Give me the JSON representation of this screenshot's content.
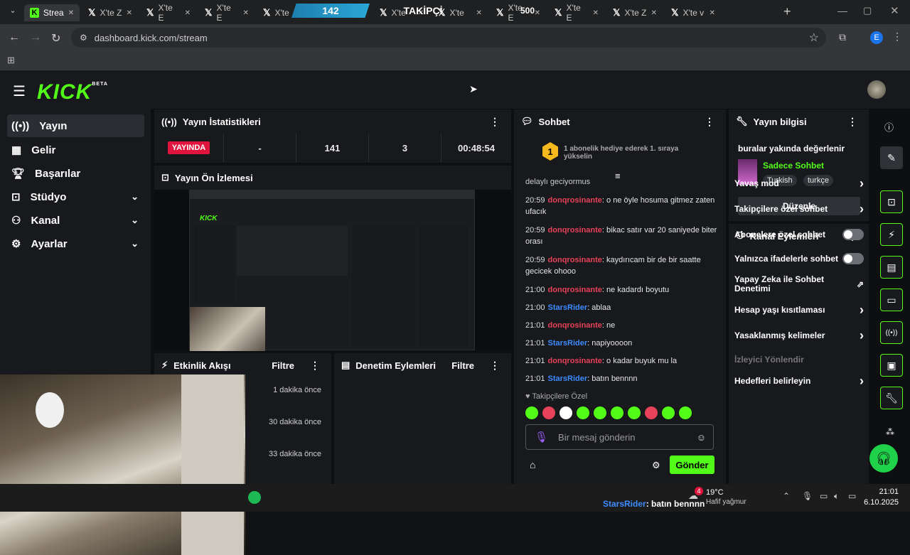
{
  "browser": {
    "tabs": [
      {
        "label": "Strea",
        "kind": "kick"
      },
      {
        "label": "X'te Z",
        "kind": "x"
      },
      {
        "label": "X'te E",
        "kind": "x"
      },
      {
        "label": "X'te E",
        "kind": "x"
      },
      {
        "label": "X'te",
        "kind": "x"
      },
      {
        "label": "X'te",
        "kind": "x"
      },
      {
        "label": "X'te",
        "kind": "x"
      },
      {
        "label": "X'te",
        "kind": "x"
      },
      {
        "label": "X'te E",
        "kind": "x"
      },
      {
        "label": "X'te E",
        "kind": "x"
      },
      {
        "label": "X'te Z",
        "kind": "x"
      },
      {
        "label": "X'te v",
        "kind": "x"
      }
    ],
    "url": "dashboard.kick.com/stream",
    "profile_initial": "E"
  },
  "overlay": {
    "count": "142",
    "label": "TAKİPÇİ",
    "goal": "500"
  },
  "nav": {
    "items": [
      {
        "label": "Yayın"
      },
      {
        "label": "Gelir"
      },
      {
        "label": "Başarılar"
      },
      {
        "label": "Stüdyo"
      },
      {
        "label": "Kanal"
      },
      {
        "label": "Ayarlar"
      }
    ]
  },
  "stats": {
    "title": "Yayın İstatistikleri",
    "live_label": "YAYINDA",
    "values": [
      "-",
      "141",
      "3",
      "00:48:54"
    ]
  },
  "preview": {
    "title": "Yayın Ön İzlemesi"
  },
  "activity": {
    "title": "Etkinlik Akışı",
    "filter_label": "Filtre",
    "times": [
      "1 dakika önce",
      "30 dakika önce",
      "33 dakika önce"
    ]
  },
  "moderation": {
    "title": "Denetim Eylemleri",
    "filter_label": "Filtre"
  },
  "chat": {
    "title": "Sohbet",
    "pinned": "1 abonelik hediye ederek 1. sıraya yükselin",
    "pinned_rank": "1",
    "partial_line": "delaylı geciyormus",
    "messages": [
      {
        "time": "20:59",
        "user": "donqrosinante",
        "color": "red",
        "text": "o ne öyle hosuma gitmez zaten ufacık"
      },
      {
        "time": "20:59",
        "user": "donqrosinante",
        "color": "red",
        "text": "bikac satır var 20 saniyede biter orası"
      },
      {
        "time": "20:59",
        "user": "donqrosinante",
        "color": "red",
        "text": "kaydırıcam bir de bir saatte gecicek ohooo"
      },
      {
        "time": "21:00",
        "user": "donqrosinante",
        "color": "red",
        "text": "ne kadardı boyutu"
      },
      {
        "time": "21:00",
        "user": "StarsRider",
        "color": "blue",
        "text": "ablaa"
      },
      {
        "time": "21:01",
        "user": "donqrosinante",
        "color": "red",
        "text": "ne"
      },
      {
        "time": "21:01",
        "user": "StarsRider",
        "color": "blue",
        "text": "napiyoooon"
      },
      {
        "time": "21:01",
        "user": "donqrosinante",
        "color": "red",
        "text": "o kadar buyuk mu la"
      },
      {
        "time": "21:01",
        "user": "StarsRider",
        "color": "blue",
        "text": "batın bennnn"
      }
    ],
    "followers_only": "Takipçilere Özel",
    "input_placeholder": "Bir mesaj gönderin",
    "send_label": "Gönder"
  },
  "stream_info": {
    "title": "Yayın bilgisi",
    "stream_title": "buralar yakında değerlenir",
    "category": "Sadece Sohbet",
    "tags": [
      "Turkish",
      "turkçe"
    ],
    "edit_label": "Düzenle"
  },
  "channel_actions": {
    "title": "Kanal Eylemleri",
    "items": [
      {
        "label": "Yavaş mod",
        "control": "chevron"
      },
      {
        "label": "Takipçilere özel sohbet",
        "control": "chevron"
      },
      {
        "label": "Abonelere özel sohbet",
        "control": "toggle"
      },
      {
        "label": "Yalnızca ifadelerle sohbet",
        "control": "toggle"
      },
      {
        "label": "Yapay Zeka ile Sohbet Denetimi",
        "control": "external"
      },
      {
        "label": "Hesap yaşı kısıtlaması",
        "control": "chevron"
      },
      {
        "label": "Yasaklanmış kelimeler",
        "control": "chevron"
      },
      {
        "label": "İzleyici Yönlendir",
        "control": "none"
      },
      {
        "label": "Hedefleri belirleyin",
        "control": "chevron"
      }
    ]
  },
  "taskbar": {
    "weather_temp": "19°C",
    "weather_desc": "Hafif yağmur",
    "weather_badge": "4",
    "time": "21:01",
    "date": "6.10.2025",
    "ticker_user": "StarsRider",
    "ticker_text": ": batın bennnn"
  },
  "colors": {
    "accent": "#53fc18",
    "live": "#e0143c",
    "user_red": "#e8415a",
    "user_blue": "#3d8bff"
  }
}
